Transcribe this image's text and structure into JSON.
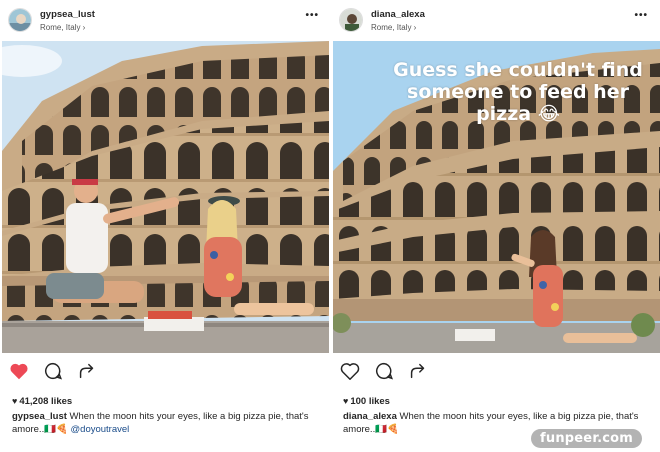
{
  "posts": [
    {
      "username": "gypsea_lust",
      "location": "Rome, Italy ›",
      "more": "•••",
      "likes": "41,208 likes",
      "caption_user": "gypsea_lust",
      "caption_text": " When the moon hits your eyes, like a big pizza pie, that's amore..🇮🇹🍕 ",
      "caption_tag": "@doyoutravel",
      "liked": true
    },
    {
      "username": "diana_alexa",
      "location": "Rome, Italy ›",
      "more": "•••",
      "likes": "100 likes",
      "caption_user": "diana_alexa",
      "caption_text": " When the moon hits your eyes, like a big pizza pie, that's amore..🇮🇹🍕",
      "overlay": "Guess she couldn't find someone to feed her pizza 😂",
      "liked": false
    }
  ],
  "watermark": "funpeer.com",
  "colors": {
    "heart_red": "#ed4956",
    "tag_blue": "#1a4c8a",
    "sky_left": "#cfe3f2",
    "sky_right": "#a9d3ef",
    "stone": "#c8ab86"
  }
}
